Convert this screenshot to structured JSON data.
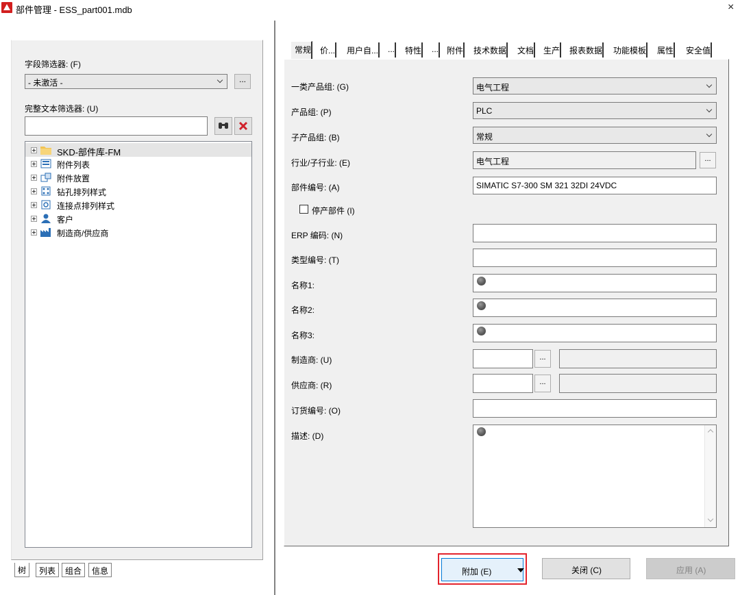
{
  "window": {
    "title": "部件管理 - ESS_part001.mdb",
    "close_glyph": "×"
  },
  "left": {
    "field_filter_label": "字段筛选器: (F)",
    "field_filter_value": "- 未激活 -",
    "field_filter_more": "...",
    "fulltext_filter_label": "完整文本筛选器: (U)",
    "fulltext_value": "",
    "tree": [
      {
        "label": "SKD-部件库-FM",
        "icon": "folder-icon",
        "selected": true
      },
      {
        "label": "附件列表",
        "icon": "list-icon"
      },
      {
        "label": "附件放置",
        "icon": "placement-icon"
      },
      {
        "label": "钻孔排列样式",
        "icon": "drill-icon"
      },
      {
        "label": "连接点排列样式",
        "icon": "connector-icon"
      },
      {
        "label": "客户",
        "icon": "customer-icon"
      },
      {
        "label": "制造商/供应商",
        "icon": "factory-icon"
      }
    ],
    "bottom_tabs": [
      "树",
      "列表",
      "组合",
      "信息"
    ]
  },
  "tabs": [
    "常规",
    "价...",
    "用户自...",
    "...",
    "特性",
    "...",
    "附件",
    "技术数据",
    "文档",
    "生产",
    "报表数据",
    "功能模板",
    "属性",
    "安全值"
  ],
  "form": {
    "product_group1_label": "一类产品组: (G)",
    "product_group1_value": "电气工程",
    "product_group_label": "产品组: (P)",
    "product_group_value": "PLC",
    "sub_group_label": "子产品组: (B)",
    "sub_group_value": "常规",
    "industry_label": "行业/子行业: (E)",
    "industry_value": "电气工程",
    "part_number_label": "部件编号: (A)",
    "part_number_value": "SIMATIC S7-300 SM 321 32DI 24VDC",
    "obsolete_label": "停产部件 (I)",
    "erp_label": "ERP 编码: (N)",
    "type_label": "类型编号: (T)",
    "name1_label": "名称1:",
    "name2_label": "名称2:",
    "name3_label": "名称3:",
    "manufacturer_label": "制造商: (U)",
    "supplier_label": "供应商: (R)",
    "order_number_label": "订货编号: (O)",
    "description_label": "描述: (D)",
    "more_btn": "..."
  },
  "buttons": {
    "add": "附加 (E)",
    "close": "关闭 (C)",
    "apply": "应用 (A)"
  },
  "colors": {
    "highlight": "#e3232c",
    "selected_tree_bg": "#e5e5e5"
  }
}
